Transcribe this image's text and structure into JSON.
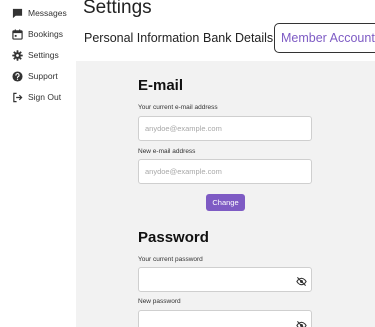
{
  "sidebar": {
    "items": [
      {
        "label": "Messages",
        "icon": "message-icon"
      },
      {
        "label": "Bookings",
        "icon": "calendar-icon"
      },
      {
        "label": "Settings",
        "icon": "gear-icon"
      },
      {
        "label": "Support",
        "icon": "help-icon"
      },
      {
        "label": "Sign Out",
        "icon": "sign-out-icon"
      }
    ]
  },
  "page": {
    "title": "Settings"
  },
  "tabs": [
    {
      "label": "Personal Information",
      "active": false
    },
    {
      "label": "Bank Details",
      "active": false
    },
    {
      "label": "Member Account",
      "active": true
    }
  ],
  "email_section": {
    "title": "E-mail",
    "current_label": "Your current e-mail address",
    "current_placeholder": "anydoe@example.com",
    "new_label": "New e-mail address",
    "new_placeholder": "anydoe@example.com",
    "change_label": "Change"
  },
  "password_section": {
    "title": "Password",
    "current_label": "Your current password",
    "new_label": "New password"
  },
  "colors": {
    "accent": "#7e5bc4",
    "panel_bg": "#f2f2f2"
  }
}
